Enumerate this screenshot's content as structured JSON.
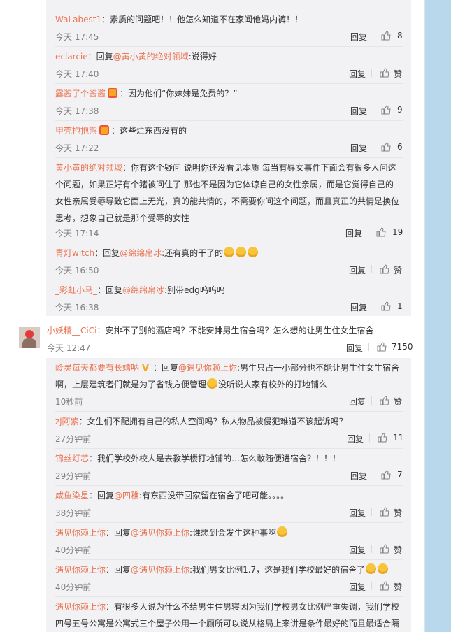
{
  "comments": [
    {
      "id": "c1",
      "user": "WaLabest1",
      "reply_prefix": "",
      "reply_to": "",
      "text": "：素质的问题吧！！他怎么知道不在家闻他妈内裤！！",
      "time": "今天 17:45",
      "reply_label": "回复",
      "likes": "8"
    },
    {
      "id": "c2",
      "user": "eclarcie",
      "reply_prefix": "：回复",
      "reply_to": "@黄小黄的绝对领域",
      "text": ":说得好",
      "time": "今天 17:40",
      "reply_label": "回复",
      "likes": "赞"
    },
    {
      "id": "c3",
      "user": "露酱了个酱酱",
      "reply_prefix": "",
      "reply_to": "",
      "text": "：因为他们“你妹妹是免费的？”",
      "time": "今天 17:38",
      "reply_label": "回复",
      "likes": "9"
    },
    {
      "id": "c4",
      "user": "甲壳抱抱熊",
      "reply_prefix": "",
      "reply_to": "",
      "text": "：这些烂东西没有的",
      "time": "今天 17:22",
      "reply_label": "回复",
      "likes": "6"
    },
    {
      "id": "c5",
      "user": "黄小黄的绝对领域",
      "reply_prefix": "",
      "reply_to": "",
      "text": "：你有这个疑问 说明你还没看见本质 每当有辱女事件下面会有很多人问这个问题，如果正好有个猪被问住了 那也不是因为它体谅自己的女性亲属，而是它觉得自己的女性亲属受辱导致它面上无光，真的能共情的，不需要你问这个问题，而且真正的共情是换位思考，想象自己就是那个受辱的女性",
      "time": "今天 17:14",
      "reply_label": "回复",
      "likes": "19"
    },
    {
      "id": "c6",
      "user": "青灯witch",
      "reply_prefix": "：回复",
      "reply_to": "@绵绵帛冰",
      "text": ":还有真的干了的",
      "time": "今天 16:50",
      "reply_label": "回复",
      "likes": "赞"
    },
    {
      "id": "c7",
      "user": "_彩虹小马_",
      "reply_prefix": "：回复",
      "reply_to": "@绵绵帛冰",
      "text": ":别带edg呜呜呜",
      "time": "今天 16:38",
      "reply_label": "回复",
      "likes": "1"
    }
  ],
  "main_comment": {
    "user": "小妖精__CiCi",
    "text": "：安排不了别的酒店吗？不能安排男生宿舍吗？怎么想的让男生住女生宿舍",
    "time": "今天 12:47",
    "reply_label": "回复",
    "likes": "7150"
  },
  "sub_comments": [
    {
      "id": "s1",
      "user": "岭灵每天都要有长靖呐",
      "reply_prefix": "：回复",
      "reply_to": "@遇见你赖上你",
      "text": ":男生只占一小部分也不能让男生住女生宿舍啊，上层建筑者们就是为了省钱方便管理",
      "text_tail": "没听说人家有校外的打地铺么",
      "time": "10秒前",
      "reply_label": "回复",
      "likes": "赞"
    },
    {
      "id": "s2",
      "user": "zj阿紫",
      "reply_prefix": "",
      "reply_to": "",
      "text": "：女生们不配拥有自己的私人空间吗？私人物品被侵犯难道不该起诉吗？",
      "time": "27分钟前",
      "reply_label": "回复",
      "likes": "11"
    },
    {
      "id": "s3",
      "user": "锦丝灯芯",
      "reply_prefix": "",
      "reply_to": "",
      "text": "：我们学校外校人是去教学楼打地铺的…怎么敢随便进宿舍？！！！",
      "time": "29分钟前",
      "reply_label": "回复",
      "likes": "7"
    },
    {
      "id": "s4",
      "user": "咸鱼染星",
      "reply_prefix": "：回复",
      "reply_to": "@四稚",
      "text": ":有东西没带回家留在宿舍了吧可能。。。。",
      "time": "38分钟前",
      "reply_label": "回复",
      "likes": "赞"
    },
    {
      "id": "s5",
      "user": "遇见你赖上你",
      "reply_prefix": "：回复",
      "reply_to": "@遇见你赖上你",
      "text": ":谁想到会发生这种事啊",
      "time": "40分钟前",
      "reply_label": "回复",
      "likes": "赞"
    },
    {
      "id": "s6",
      "user": "遇见你赖上你",
      "reply_prefix": "：回复",
      "reply_to": "@遇见你赖上你",
      "text": ":我们男女比例1.7，这是我们学校最好的宿舍了",
      "time": "40分钟前",
      "reply_label": "回复",
      "likes": "赞"
    },
    {
      "id": "s7",
      "user": "遇见你赖上你",
      "reply_prefix": "",
      "reply_to": "",
      "text": "：有很多人说为什么不给男生住男寝因为我们学校男女比例严重失调，我们学校四号五号公寓是公寓式三个屋子公用一个厕所可以说从格局上来讲是条件最好的而且最适合隔"
    }
  ]
}
